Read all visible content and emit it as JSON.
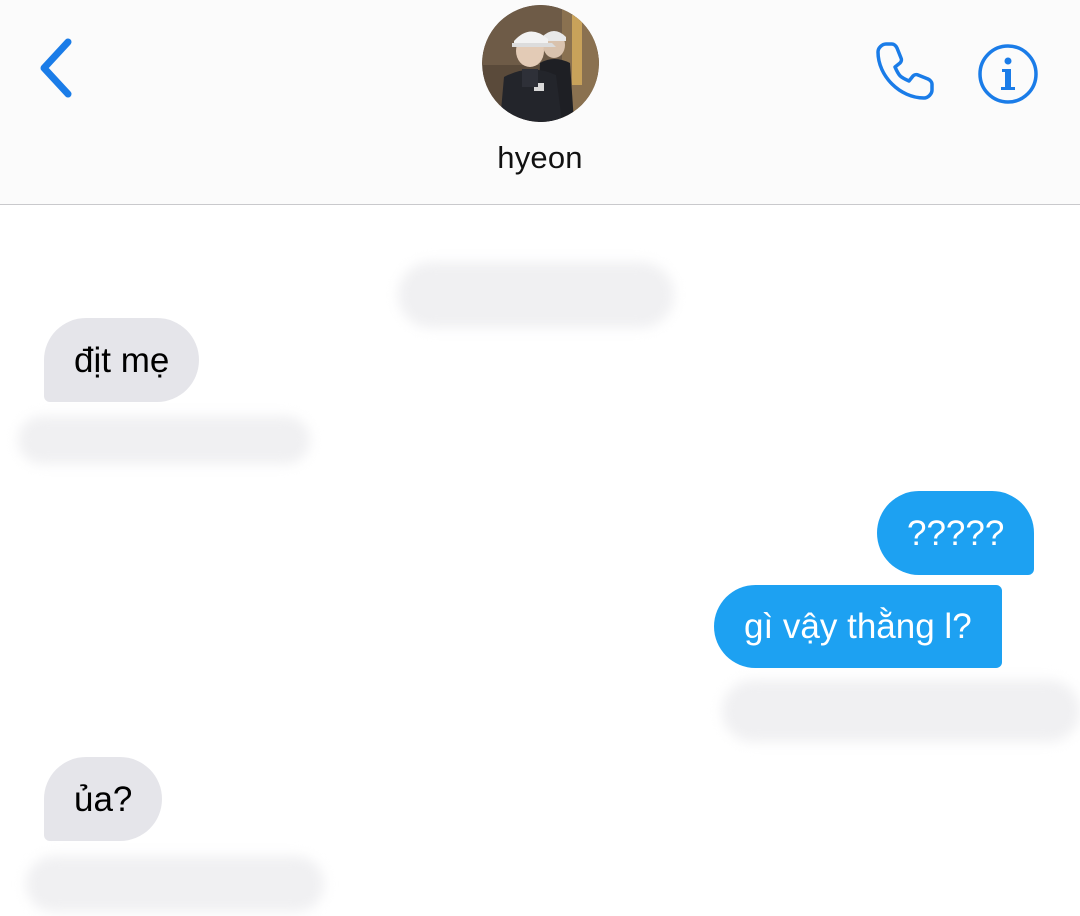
{
  "header": {
    "contact_name": "hyeon",
    "back_icon": "chevron-left-icon",
    "call_icon": "phone-icon",
    "info_icon": "info-circle-icon"
  },
  "colors": {
    "accent": "#1a7ce8",
    "outgoing_bubble": "#1da1f2",
    "incoming_bubble": "#e5e5ea",
    "header_bg": "#fbfbfb"
  },
  "messages": [
    {
      "direction": "incoming",
      "text": "địt mẹ"
    },
    {
      "direction": "outgoing",
      "text": "?????"
    },
    {
      "direction": "outgoing",
      "text": "gì vậy thằng l?"
    },
    {
      "direction": "incoming",
      "text": "ủa?"
    }
  ]
}
